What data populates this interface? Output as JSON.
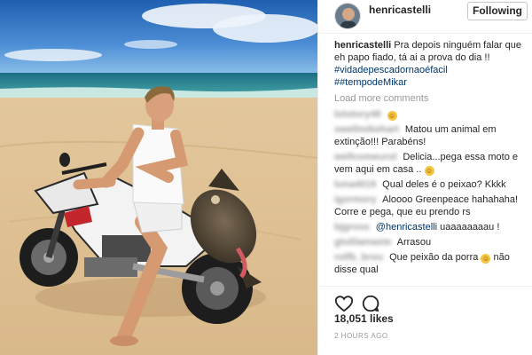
{
  "post": {
    "username": "henricastelli",
    "follow_label": "Following",
    "caption_text": "Pra depois ninguém falar que eh papo fiado, tá ai a prova do dia !!",
    "hashtags": [
      "#vidadepescadornaoéfacil",
      "##tempodeMikar"
    ],
    "load_more": "Load more comments",
    "likes": "18,051 likes",
    "time": "2 HOURS AGO"
  },
  "comments": [
    {
      "user": "lolotory48",
      "text": "",
      "emoji": "happy-face-icon"
    },
    {
      "user": "swellmikehart",
      "text": "Matou um animal em extinção!!! Parabéns!"
    },
    {
      "user": "wellcomeurol",
      "text": "Delicia...pega essa moto e vem aqui em casa ..",
      "emoji": "sweat-smile-icon"
    },
    {
      "user": "luna4019",
      "text": "Qual deles é o peixao? Kkkk"
    },
    {
      "user": "igormory",
      "text": "Aloooo Greenpeace hahahaha! Corre e pega, que eu prendo rs"
    },
    {
      "user": "bjgross",
      "text": "uaaaaaaaau !",
      "mention": "@henricastelli"
    },
    {
      "user": "gtulilamaste",
      "text": "Arrasou"
    },
    {
      "user": "rolfb_brou",
      "text": "Que peixão da porra",
      "emoji": "relieved-face-icon",
      "tail": "não disse qual"
    }
  ],
  "icons": {
    "like": "heart-outline-icon",
    "comment": "comment-bubble-icon"
  },
  "colors": {
    "link": "#003569",
    "muted": "#999999",
    "text": "#262626"
  }
}
